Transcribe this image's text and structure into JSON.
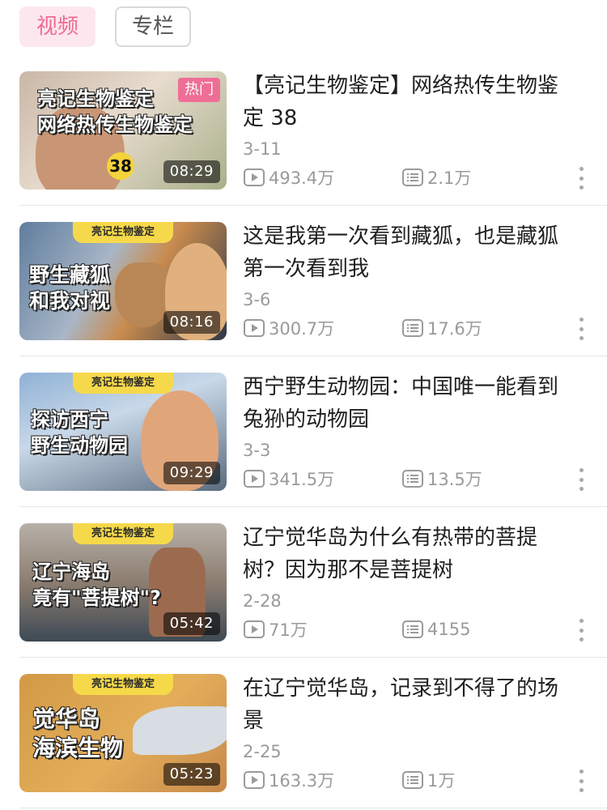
{
  "tabs": {
    "active": "视频",
    "other": "专栏"
  },
  "videos": [
    {
      "title": "【亮记生物鉴定】网络热传生物鉴定 38",
      "date": "3-11",
      "views": "493.4万",
      "danmaku": "2.1万",
      "duration": "08:29",
      "badge": "热门",
      "overlay": "亮记生物鉴定\n网络热传生物鉴定",
      "number": "38"
    },
    {
      "title": "这是我第一次看到藏狐，也是藏狐第一次看到我",
      "date": "3-6",
      "views": "300.7万",
      "danmaku": "17.6万",
      "duration": "08:16",
      "banner": "亮记生物鉴定",
      "overlay": "野生藏狐\n和我对视"
    },
    {
      "title": "西宁野生动物园：中国唯一能看到兔狲的动物园",
      "date": "3-3",
      "views": "341.5万",
      "danmaku": "13.5万",
      "duration": "09:29",
      "banner": "亮记生物鉴定",
      "overlay": "探访西宁\n野生动物园"
    },
    {
      "title": "辽宁觉华岛为什么有热带的菩提树？因为那不是菩提树",
      "date": "2-28",
      "views": "71万",
      "danmaku": "4155",
      "duration": "05:42",
      "banner": "亮记生物鉴定",
      "overlay": "辽宁海岛\n竟有\"菩提树\"?"
    },
    {
      "title": "在辽宁觉华岛，记录到不得了的场景",
      "date": "2-25",
      "views": "163.3万",
      "danmaku": "1万",
      "duration": "05:23",
      "banner": "亮记生物鉴定",
      "overlay": "觉华岛\n海滨生物"
    }
  ],
  "icons": {
    "views": "play-count-icon",
    "danmaku": "danmaku-count-icon",
    "more": "more-vertical-icon"
  },
  "colors": {
    "accent": "#ee6a92",
    "badge": "#ef6e96",
    "banner": "#f6d94a",
    "meta": "#9a9a9a"
  }
}
